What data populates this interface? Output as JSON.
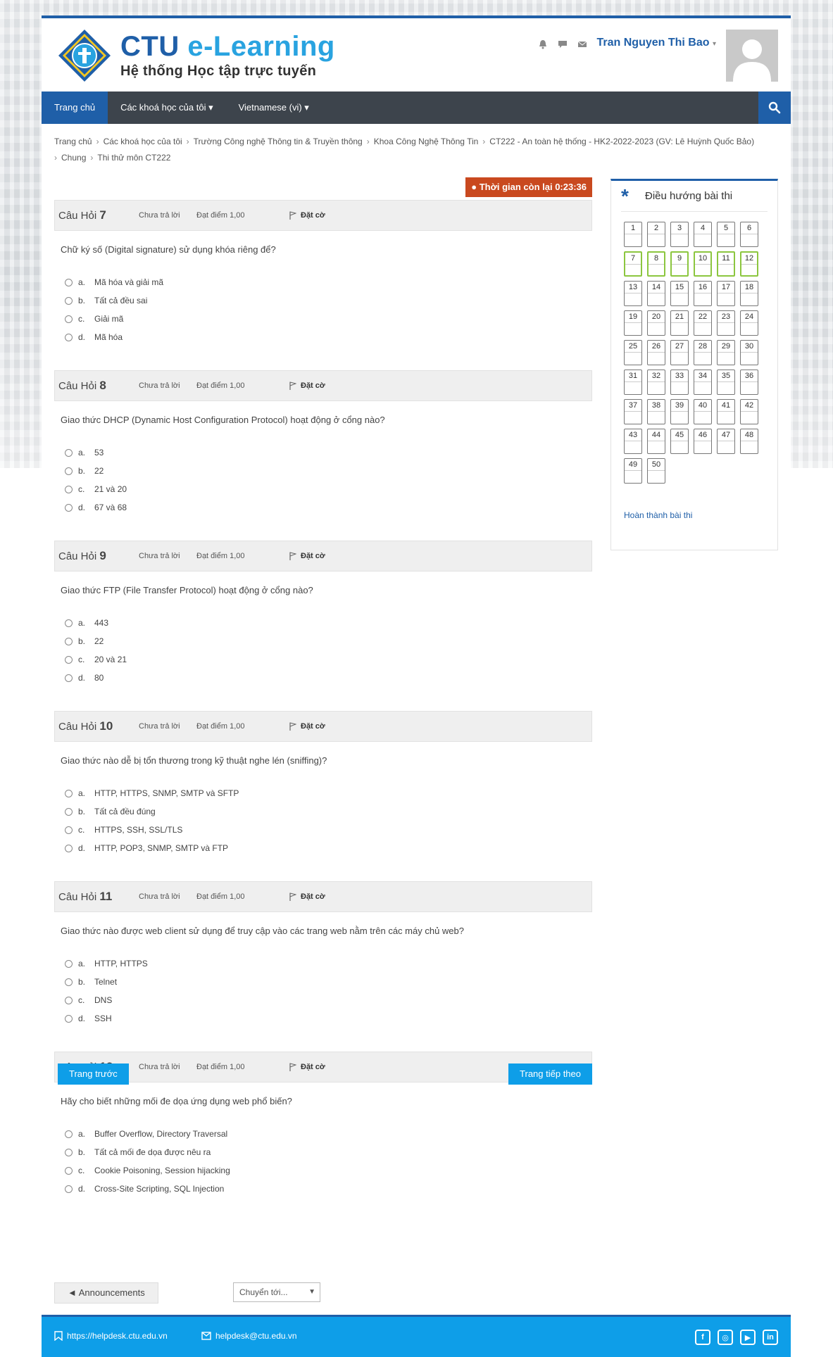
{
  "brand": {
    "title_main": "CTU",
    "title_accent": "e-Learning",
    "subtitle": "Hệ thống Học tập trực tuyến",
    "logo_icon": "ctu-seal-logo"
  },
  "user": {
    "name": "Tran Nguyen Thi Bao",
    "icons": [
      "bell-icon",
      "chat-icon",
      "mail-icon"
    ]
  },
  "nav": {
    "items": [
      {
        "label": "Trang chủ",
        "active": true
      },
      {
        "label": "Các khoá học của tôi ▾",
        "active": false
      },
      {
        "label": "Vietnamese (vi) ▾",
        "active": false
      }
    ],
    "search_icon": "search-icon"
  },
  "breadcrumb": [
    "Trang chủ",
    "Các khoá học của tôi",
    "Trường Công nghệ Thông tin & Truyền thông",
    "Khoa Công Nghệ Thông Tin",
    "CT222 - An toàn hệ thống - HK2-2022-2023 (GV: Lê Huỳnh Quốc Bảo)",
    "Chung",
    "Thi thử môn CT222"
  ],
  "timer": "Thời gian còn lại 0:23:36",
  "questions": [
    {
      "label": "Câu Hỏi",
      "number": "7",
      "state": "Chưa trả lời",
      "grade": "Đạt điểm 1,00",
      "flag": "Đặt cờ",
      "text": "Chữ ký số (Digital signature) sử dụng khóa riêng để?",
      "options": [
        {
          "letter": "a.",
          "text": "Mã hóa và giải mã"
        },
        {
          "letter": "b.",
          "text": "Tất cả đều sai"
        },
        {
          "letter": "c.",
          "text": "Giải mã"
        },
        {
          "letter": "d.",
          "text": "Mã hóa"
        }
      ]
    },
    {
      "label": "Câu Hỏi",
      "number": "8",
      "state": "Chưa trả lời",
      "grade": "Đạt điểm 1,00",
      "flag": "Đặt cờ",
      "text": "Giao thức DHCP (Dynamic Host Configuration Protocol) hoạt động ở cổng nào?",
      "options": [
        {
          "letter": "a.",
          "text": "53"
        },
        {
          "letter": "b.",
          "text": "22"
        },
        {
          "letter": "c.",
          "text": "21 và 20"
        },
        {
          "letter": "d.",
          "text": "67 và 68"
        }
      ]
    },
    {
      "label": "Câu Hỏi",
      "number": "9",
      "state": "Chưa trả lời",
      "grade": "Đạt điểm 1,00",
      "flag": "Đặt cờ",
      "text": "Giao thức FTP (File Transfer Protocol) hoạt động ở cổng nào?",
      "options": [
        {
          "letter": "a.",
          "text": "443"
        },
        {
          "letter": "b.",
          "text": "22"
        },
        {
          "letter": "c.",
          "text": "20 và 21"
        },
        {
          "letter": "d.",
          "text": "80"
        }
      ]
    },
    {
      "label": "Câu Hỏi",
      "number": "10",
      "state": "Chưa trả lời",
      "grade": "Đạt điểm 1,00",
      "flag": "Đặt cờ",
      "text": "Giao thức nào dễ bị tổn thương trong kỹ thuật nghe lén (sniffing)?",
      "options": [
        {
          "letter": "a.",
          "text": "HTTP, HTTPS, SNMP, SMTP và SFTP"
        },
        {
          "letter": "b.",
          "text": "Tất cả đều đúng"
        },
        {
          "letter": "c.",
          "text": "HTTPS, SSH, SSL/TLS"
        },
        {
          "letter": "d.",
          "text": "HTTP, POP3, SNMP, SMTP và FTP"
        }
      ]
    },
    {
      "label": "Câu Hỏi",
      "number": "11",
      "state": "Chưa trả lời",
      "grade": "Đạt điểm 1,00",
      "flag": "Đặt cờ",
      "text": "Giao thức nào được web client sử dụng để truy cập vào các trang web nằm trên các máy chủ web?",
      "options": [
        {
          "letter": "a.",
          "text": "HTTP, HTTPS"
        },
        {
          "letter": "b.",
          "text": "Telnet"
        },
        {
          "letter": "c.",
          "text": "DNS"
        },
        {
          "letter": "d.",
          "text": "SSH"
        }
      ]
    },
    {
      "label": "Câu Hỏi",
      "number": "12",
      "state": "Chưa trả lời",
      "grade": "Đạt điểm 1,00",
      "flag": "Đặt cờ",
      "text": "Hãy cho biết những mối đe dọa ứng dụng web phổ biến?",
      "options": [
        {
          "letter": "a.",
          "text": "Buffer Overflow, Directory Traversal"
        },
        {
          "letter": "b.",
          "text": "Tất cả mối đe dọa được nêu ra"
        },
        {
          "letter": "c.",
          "text": "Cookie Poisoning, Session hijacking"
        },
        {
          "letter": "d.",
          "text": "Cross-Site Scripting, SQL Injection"
        }
      ]
    }
  ],
  "pager": {
    "prev": "Trang trước",
    "next": "Trang tiếp theo"
  },
  "bottom_nav": {
    "announcements": "◄ Announcements",
    "jump": "Chuyển tới..."
  },
  "sidebar": {
    "title": "Điều hướng bài thi",
    "cells": [
      "1",
      "2",
      "3",
      "4",
      "5",
      "6",
      "7",
      "8",
      "9",
      "10",
      "11",
      "12",
      "13",
      "14",
      "15",
      "16",
      "17",
      "18",
      "19",
      "20",
      "21",
      "22",
      "23",
      "24",
      "25",
      "26",
      "27",
      "28",
      "29",
      "30",
      "31",
      "32",
      "33",
      "34",
      "35",
      "36",
      "37",
      "38",
      "39",
      "40",
      "41",
      "42",
      "43",
      "44",
      "45",
      "46",
      "47",
      "48",
      "49",
      "50"
    ],
    "current_page": [
      "7",
      "8",
      "9",
      "10",
      "11",
      "12"
    ],
    "finish": "Hoàn thành bài thi"
  },
  "footer": {
    "helpdesk_url": "https://helpdesk.ctu.edu.vn",
    "email": "helpdesk@ctu.edu.vn",
    "social": [
      "facebook-icon",
      "instagram-icon",
      "youtube-icon",
      "linkedin-icon"
    ]
  },
  "colors": {
    "brand_blue": "#1f5fa8",
    "accent_blue": "#0e9ee8",
    "nav_dark": "#3d444c",
    "timer_bg": "#c9491f",
    "current_cell": "#8cc63f"
  }
}
